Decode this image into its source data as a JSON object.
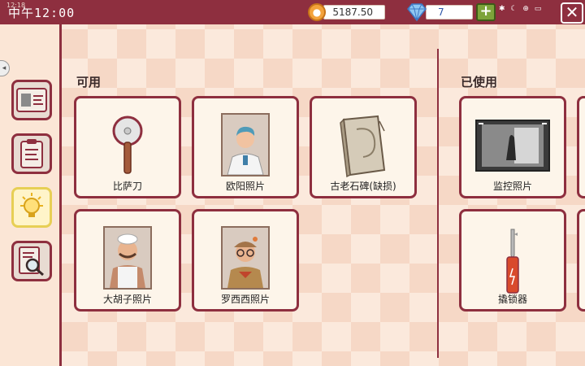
{
  "status": {
    "time": "中午12:00",
    "small_text": "12:18"
  },
  "resources": {
    "coins": "5187.50",
    "gems": "7",
    "add_label": "+"
  },
  "close_label": "✕",
  "sections": {
    "available": "可用",
    "used": "已使用"
  },
  "available_items": [
    {
      "label": "比萨刀"
    },
    {
      "label": "欧阳照片"
    },
    {
      "label": "古老石碑(缺损)"
    },
    {
      "label": "大胡子照片"
    },
    {
      "label": "罗西西照片"
    }
  ],
  "used_items": [
    {
      "label": "监控照片"
    },
    {
      "label": "撬锁器"
    }
  ],
  "colors": {
    "accent": "#8e2f3f",
    "card_bg": "#fdf5ea",
    "active_tab": "#e7cf55"
  }
}
